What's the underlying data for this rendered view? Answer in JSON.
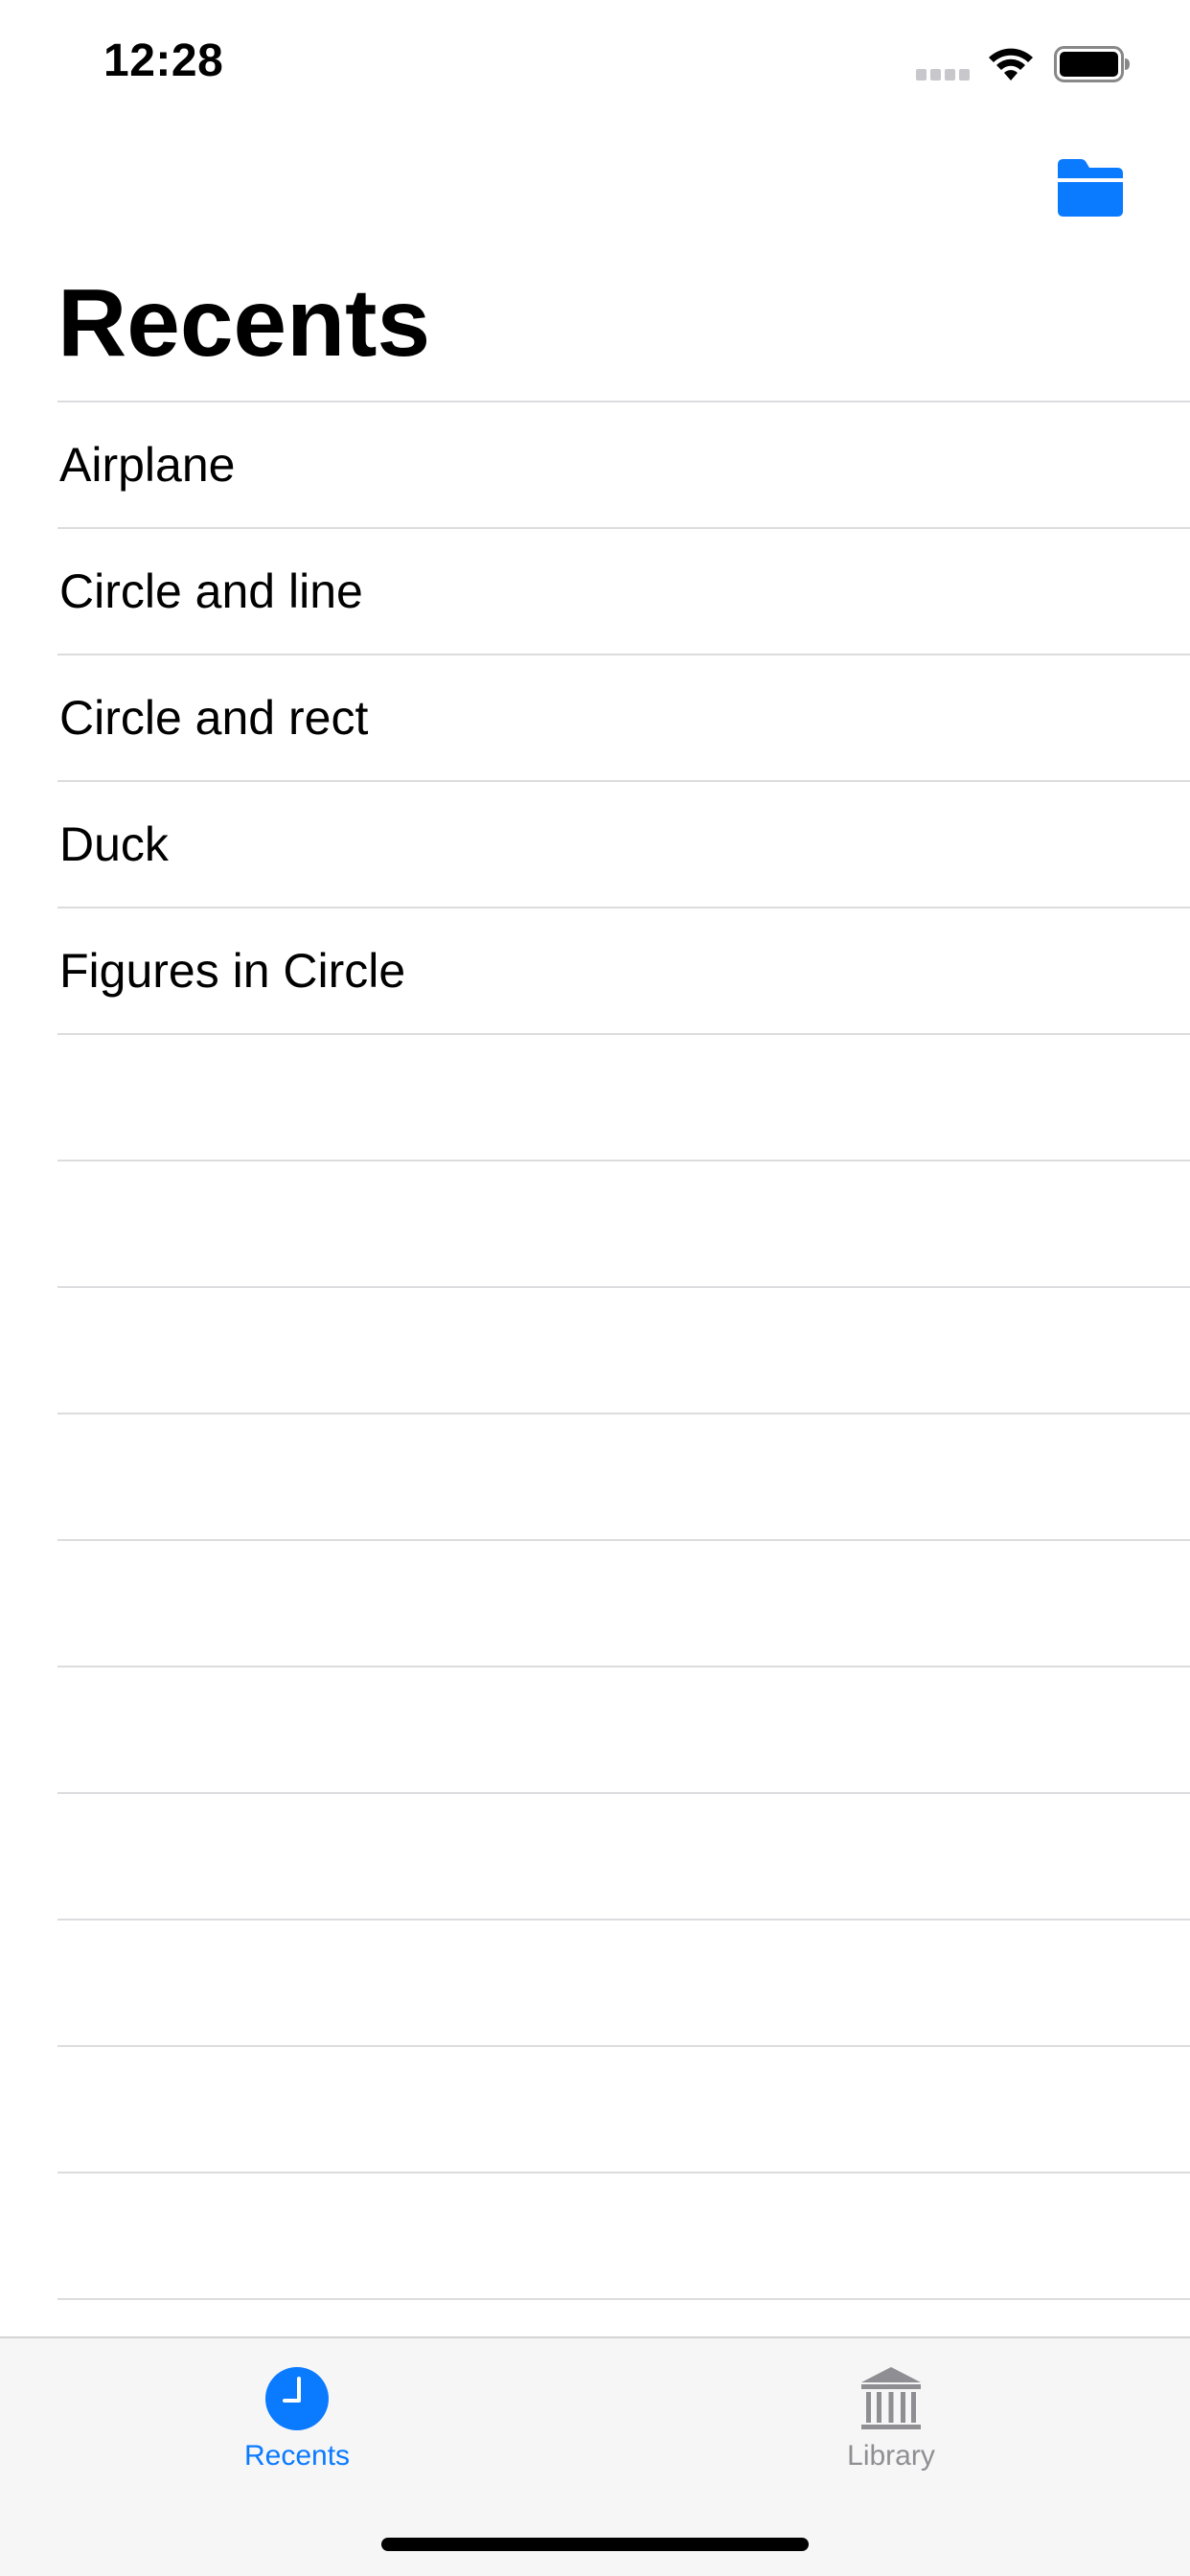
{
  "status_bar": {
    "time": "12:28"
  },
  "nav": {
    "title": "Recents",
    "folder_button_icon": "folder-icon"
  },
  "list": {
    "items": [
      {
        "label": "Airplane"
      },
      {
        "label": "Circle and line"
      },
      {
        "label": "Circle and rect"
      },
      {
        "label": "Duck"
      },
      {
        "label": "Figures in Circle"
      },
      {
        "label": ""
      },
      {
        "label": ""
      },
      {
        "label": ""
      },
      {
        "label": ""
      },
      {
        "label": ""
      },
      {
        "label": ""
      },
      {
        "label": ""
      },
      {
        "label": ""
      },
      {
        "label": ""
      },
      {
        "label": ""
      },
      {
        "label": ""
      }
    ]
  },
  "tab_bar": {
    "tabs": [
      {
        "label": "Recents",
        "icon": "clock-icon",
        "selected": true
      },
      {
        "label": "Library",
        "icon": "library-icon",
        "selected": false
      }
    ]
  },
  "colors": {
    "accent": "#0a7aff",
    "inactive": "#8e8e93",
    "separator": "#dcdcdf",
    "tab_bar_bg": "#f6f6f6"
  }
}
